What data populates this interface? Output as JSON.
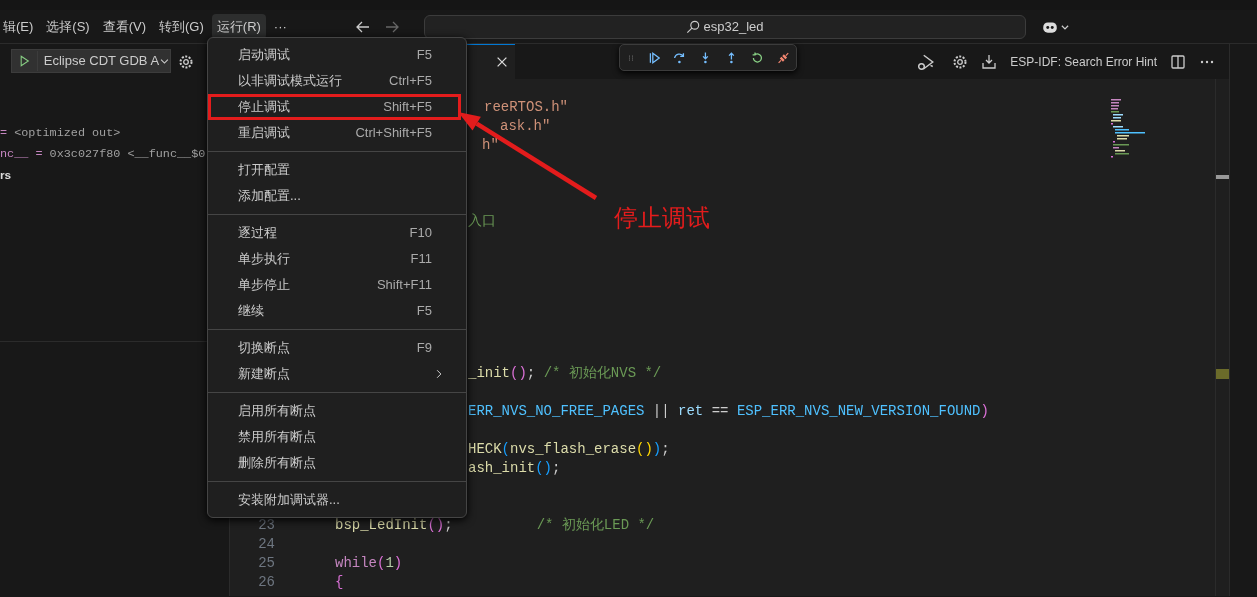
{
  "menubar": [
    {
      "label": "辑(E)",
      "selected": false
    },
    {
      "label": "选择(S)",
      "selected": false
    },
    {
      "label": "查看(V)",
      "selected": false
    },
    {
      "label": "转到(G)",
      "selected": false
    },
    {
      "label": "运行(R)",
      "selected": true
    },
    {
      "label": "···",
      "selected": false
    }
  ],
  "command_center": {
    "value": "esp32_led"
  },
  "sidebar": {
    "configuration": "Eclipse CDT GDB A",
    "variables": [
      [
        {
          "kind": "op",
          "text": "="
        },
        {
          "kind": "value",
          "text": "<optimized out>"
        }
      ],
      [
        {
          "kind": "name",
          "text": "nc__"
        },
        {
          "kind": "op",
          "text": "="
        },
        {
          "kind": "value",
          "text": "0x3c027f80 <__func__$0"
        }
      ],
      [
        {
          "kind": "heading",
          "text": "rs"
        }
      ]
    ]
  },
  "editor_actions": {
    "hint": "ESP-IDF: Search Error Hint"
  },
  "code_lines": [
    {
      "kind": "code",
      "tokens": [
        {
          "kind": "str",
          "text": "reeRTOS.h\""
        }
      ]
    },
    {
      "kind": "code",
      "tokens": [
        {
          "kind": "str",
          "text": "ask.h\""
        }
      ]
    },
    {
      "kind": "code",
      "tokens": [
        {
          "kind": "str",
          "text": "h\""
        }
      ]
    },
    {
      "kind": "blank"
    },
    {
      "kind": "blank"
    },
    {
      "kind": "blank"
    },
    {
      "kind": "code",
      "tokens": [
        {
          "kind": "comment",
          "text": "入口"
        }
      ]
    },
    {
      "kind": "blank"
    },
    {
      "kind": "blank"
    },
    {
      "kind": "blank"
    },
    {
      "kind": "blank"
    },
    {
      "kind": "blank"
    },
    {
      "kind": "blank"
    },
    {
      "kind": "blank"
    },
    {
      "kind": "code",
      "tokens": [
        {
          "kind": "fn",
          "text": "_init"
        },
        {
          "kind": "p2",
          "text": "()"
        },
        {
          "kind": "plain",
          "text": "; "
        },
        {
          "kind": "comment",
          "text": "/* 初始化NVS */"
        }
      ]
    },
    {
      "kind": "blank"
    },
    {
      "kind": "code",
      "tokens": [
        {
          "kind": "const",
          "text": "ERR_NVS_NO_FREE_PAGES"
        },
        {
          "kind": "plain",
          "text": " || "
        },
        {
          "kind": "var",
          "text": "ret"
        },
        {
          "kind": "plain",
          "text": " == "
        },
        {
          "kind": "const",
          "text": "ESP_ERR_NVS_NEW_VERSION_FOUND"
        },
        {
          "kind": "p2",
          "text": ")"
        }
      ]
    },
    {
      "kind": "blank"
    },
    {
      "kind": "code",
      "tokens": [
        {
          "kind": "fn",
          "text": "HECK"
        },
        {
          "kind": "p3",
          "text": "("
        },
        {
          "kind": "fn",
          "text": "nvs_flash_erase"
        },
        {
          "kind": "p1",
          "text": "()"
        },
        {
          "kind": "p3",
          "text": ")"
        },
        {
          "kind": "plain",
          "text": ";"
        }
      ]
    },
    {
      "kind": "code",
      "tokens": [
        {
          "kind": "fn",
          "text": "ash_init"
        },
        {
          "kind": "p3",
          "text": "()"
        },
        {
          "kind": "plain",
          "text": ";"
        }
      ]
    },
    {
      "kind": "blank"
    },
    {
      "kind": "blank"
    },
    {
      "number": "23",
      "kind": "code",
      "tokens": [
        {
          "kind": "fn",
          "text": "bsp_LedInit"
        },
        {
          "kind": "p2",
          "text": "()"
        },
        {
          "kind": "plain",
          "text": ";          "
        },
        {
          "kind": "comment",
          "text": "/* 初始化LED */"
        }
      ]
    },
    {
      "number": "24",
      "kind": "blank"
    },
    {
      "number": "25",
      "kind": "code",
      "tokens": [
        {
          "kind": "kw",
          "text": "while"
        },
        {
          "kind": "p2",
          "text": "("
        },
        {
          "kind": "num",
          "text": "1"
        },
        {
          "kind": "p2",
          "text": ")"
        }
      ]
    },
    {
      "number": "26",
      "kind": "code",
      "tokens": [
        {
          "kind": "p2",
          "text": "{"
        }
      ]
    }
  ],
  "run_menu": [
    [
      {
        "label": "启动调试",
        "shortcut": "F5",
        "annotated": false,
        "submenu": false
      },
      {
        "label": "以非调试模式运行",
        "shortcut": "Ctrl+F5",
        "annotated": false,
        "submenu": false
      },
      {
        "label": "停止调试",
        "shortcut": "Shift+F5",
        "annotated": true,
        "submenu": false
      },
      {
        "label": "重启调试",
        "shortcut": "Ctrl+Shift+F5",
        "annotated": false,
        "submenu": false
      }
    ],
    [
      {
        "label": "打开配置",
        "annotated": false,
        "submenu": false
      },
      {
        "label": "添加配置...",
        "annotated": false,
        "submenu": false
      }
    ],
    [
      {
        "label": "逐过程",
        "shortcut": "F10",
        "annotated": false,
        "submenu": false
      },
      {
        "label": "单步执行",
        "shortcut": "F11",
        "annotated": false,
        "submenu": false
      },
      {
        "label": "单步停止",
        "shortcut": "Shift+F11",
        "annotated": false,
        "submenu": false
      },
      {
        "label": "继续",
        "shortcut": "F5",
        "annotated": false,
        "submenu": false
      }
    ],
    [
      {
        "label": "切换断点",
        "shortcut": "F9",
        "annotated": false,
        "submenu": false
      },
      {
        "label": "新建断点",
        "annotated": false,
        "submenu": true
      }
    ],
    [
      {
        "label": "启用所有断点",
        "annotated": false,
        "submenu": false
      },
      {
        "label": "禁用所有断点",
        "annotated": false,
        "submenu": false
      },
      {
        "label": "删除所有断点",
        "annotated": false,
        "submenu": false
      }
    ],
    [
      {
        "label": "安装附加调试器...",
        "annotated": false,
        "submenu": false
      }
    ]
  ],
  "annotation": {
    "text": "停止调试"
  }
}
